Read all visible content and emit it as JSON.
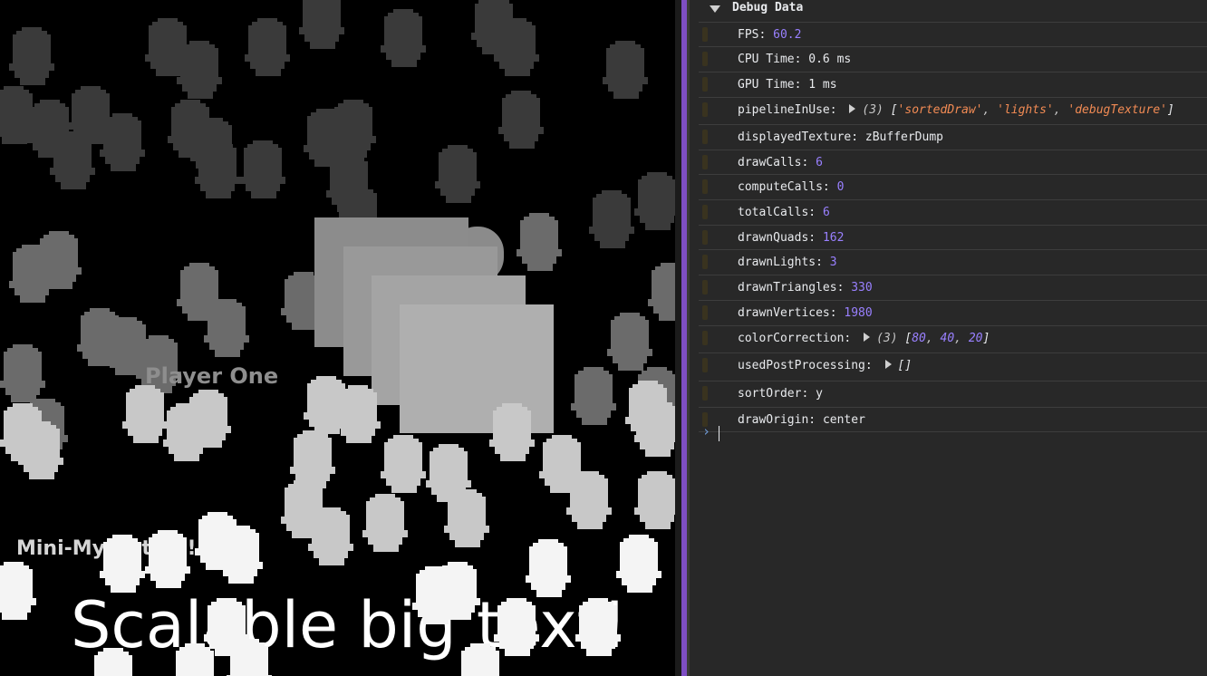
{
  "viewport": {
    "label_player": "Player One",
    "label_mini": "Mini-My ... text!",
    "label_big": "Scalable big text!"
  },
  "console": {
    "group_title": "Debug Data",
    "rows": [
      {
        "key": "FPS",
        "value": "60.2",
        "kind": "num"
      },
      {
        "key": "CPU Time",
        "value": "0.6 ms",
        "kind": "plain"
      },
      {
        "key": "GPU Time",
        "value": "1 ms",
        "kind": "plain"
      },
      {
        "key": "pipelineInUse",
        "kind": "array",
        "count": "(3)",
        "items": [
          "'sortedDraw'",
          "'lights'",
          "'debugTexture'"
        ],
        "item_kind": "str"
      },
      {
        "key": "displayedTexture",
        "value": "zBufferDump",
        "kind": "plain"
      },
      {
        "key": "drawCalls",
        "value": "6",
        "kind": "num"
      },
      {
        "key": "computeCalls",
        "value": "0",
        "kind": "num"
      },
      {
        "key": "totalCalls",
        "value": "6",
        "kind": "num"
      },
      {
        "key": "drawnQuads",
        "value": "162",
        "kind": "num"
      },
      {
        "key": "drawnLights",
        "value": "3",
        "kind": "num"
      },
      {
        "key": "drawnTriangles",
        "value": "330",
        "kind": "num"
      },
      {
        "key": "drawnVertices",
        "value": "1980",
        "kind": "num"
      },
      {
        "key": "colorCorrection",
        "kind": "array",
        "count": "(3)",
        "items": [
          "80",
          "40",
          "20"
        ],
        "item_kind": "num"
      },
      {
        "key": "usedPostProcessing",
        "kind": "array",
        "count": "",
        "items": [],
        "item_kind": "num"
      },
      {
        "key": "sortOrder",
        "value": "y",
        "kind": "plain"
      },
      {
        "key": "drawOrigin",
        "value": "center",
        "kind": "plain"
      }
    ],
    "prompt_symbol": "›"
  }
}
